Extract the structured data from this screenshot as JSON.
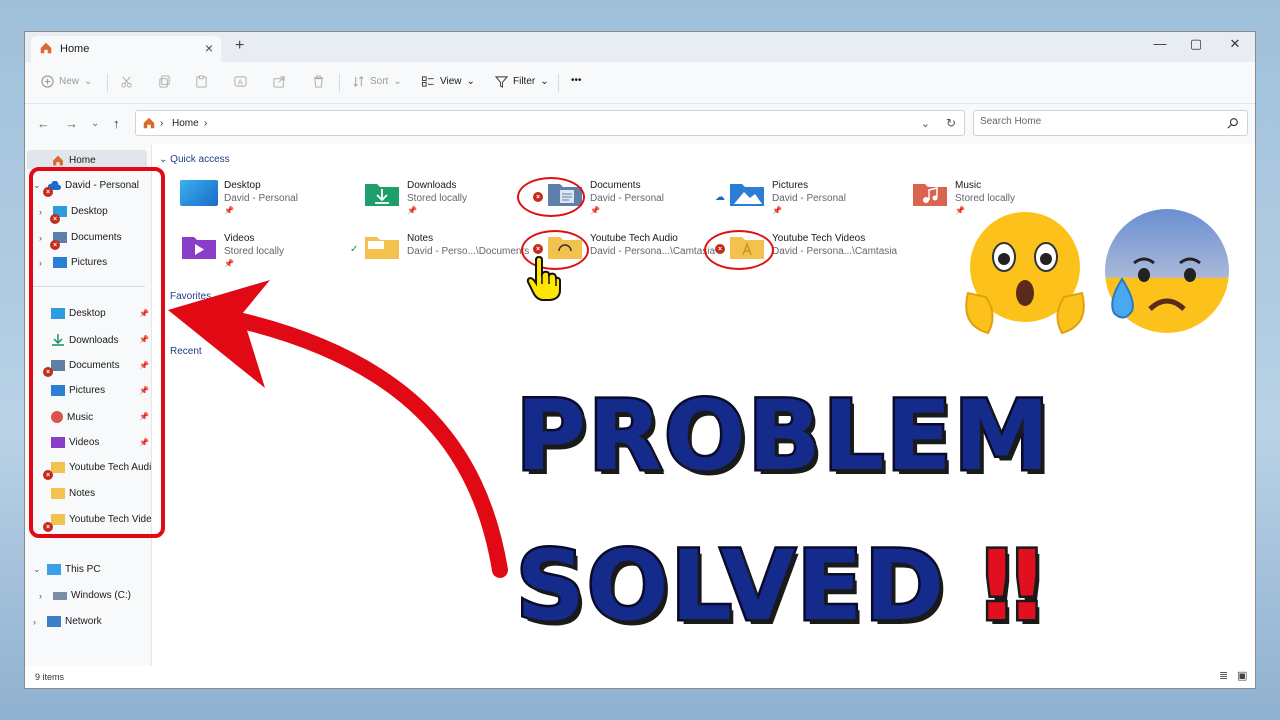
{
  "tab": {
    "title": "Home",
    "close": "×",
    "new": "+"
  },
  "window_controls": {
    "minimize": "—",
    "maximize": "▢",
    "close": "✕"
  },
  "toolbar": {
    "new_label": "New",
    "sort_label": "Sort",
    "view_label": "View",
    "filter_label": "Filter",
    "more_label": "•••"
  },
  "address": {
    "breadcrumb": "Home",
    "sep": "›",
    "search_placeholder": "Search Home"
  },
  "sidebar": {
    "home": "Home",
    "onedrive": "David - Personal",
    "onedrive_children": [
      "Desktop",
      "Documents",
      "Pictures"
    ],
    "pinned": [
      {
        "label": "Desktop"
      },
      {
        "label": "Downloads"
      },
      {
        "label": "Documents"
      },
      {
        "label": "Pictures"
      },
      {
        "label": "Music"
      },
      {
        "label": "Videos"
      },
      {
        "label": "Youtube Tech Audio"
      },
      {
        "label": "Notes"
      },
      {
        "label": "Youtube Tech Videos"
      }
    ],
    "this_pc": "This PC",
    "windows_c": "Windows (C:)",
    "network": "Network"
  },
  "content": {
    "quick_access": "Quick access",
    "favorites": "Favorites",
    "recent": "Recent",
    "items": [
      {
        "name": "Desktop",
        "sub": "David - Personal"
      },
      {
        "name": "Downloads",
        "sub": "Stored locally"
      },
      {
        "name": "Documents",
        "sub": "David - Personal"
      },
      {
        "name": "Pictures",
        "sub": "David - Personal"
      },
      {
        "name": "Music",
        "sub": "Stored locally"
      },
      {
        "name": "Videos",
        "sub": "Stored locally"
      },
      {
        "name": "Notes",
        "sub": "David - Perso...\\Documents"
      },
      {
        "name": "Youtube Tech Audio",
        "sub": "David - Persona...\\Camtasia"
      },
      {
        "name": "Youtube Tech Videos",
        "sub": "David - Persona...\\Camtasia"
      }
    ]
  },
  "status": {
    "count": "9 items"
  },
  "overlay": {
    "line1": "PROBLEM",
    "line2": "SOLVED",
    "bang": "‼"
  },
  "colors": {
    "error": "#c42b1c",
    "accent": "#142b8c",
    "annotation_red": "#e10a14"
  }
}
